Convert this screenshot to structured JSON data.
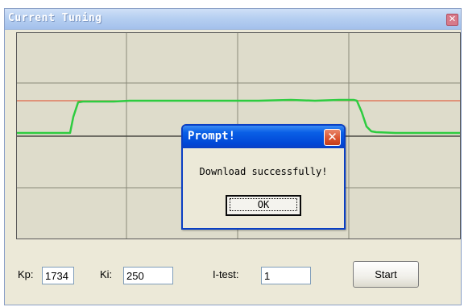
{
  "window": {
    "title": "Current Tuning",
    "close_glyph": "✕"
  },
  "plot": {
    "grid_color": "#8a8a7a",
    "setpoint_color": "#e04a2a",
    "trace_color": "#2ecc40",
    "background": "#dedccb"
  },
  "fields": {
    "kp_label": "Kp:",
    "kp_value": "1734",
    "ki_label": "Ki:",
    "ki_value": "250",
    "itest_label": "I-test:",
    "itest_value": "1"
  },
  "start_button": "Start",
  "dialog": {
    "title": "Prompt!",
    "close_glyph": "✕",
    "message": "Download successfully!",
    "ok_label": "OK"
  }
}
